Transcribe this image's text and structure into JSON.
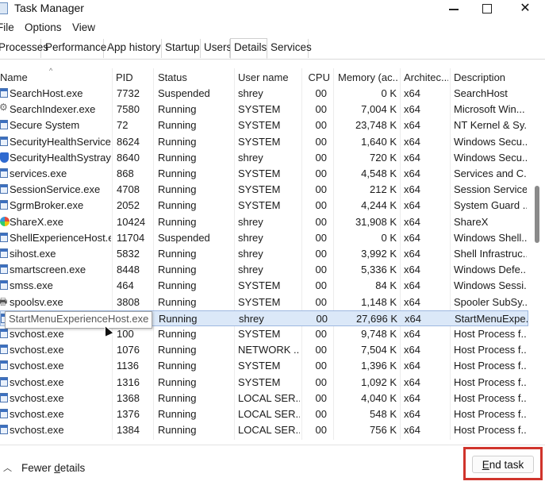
{
  "window": {
    "title": "Task Manager",
    "min_glyph": "—",
    "max_glyph": "",
    "close_glyph": "✕"
  },
  "menu": [
    "File",
    "Options",
    "View"
  ],
  "tabs": [
    {
      "label": "Processes",
      "active": false
    },
    {
      "label": "Performance",
      "active": false
    },
    {
      "label": "App history",
      "active": false
    },
    {
      "label": "Startup",
      "active": false
    },
    {
      "label": "Users",
      "active": false
    },
    {
      "label": "Details",
      "active": true
    },
    {
      "label": "Services",
      "active": false
    }
  ],
  "columns": [
    "Name",
    "PID",
    "Status",
    "User name",
    "CPU",
    "Memory (ac...",
    "Architec...",
    "Description"
  ],
  "sort_indicator": "^",
  "rows": [
    {
      "icon": "window",
      "name": "SearchHost.exe",
      "pid": "7732",
      "status": "Suspended",
      "user": "shrey",
      "cpu": "00",
      "mem": "0 K",
      "arch": "x64",
      "desc": "SearchHost"
    },
    {
      "icon": "gear",
      "name": "SearchIndexer.exe",
      "pid": "7580",
      "status": "Running",
      "user": "SYSTEM",
      "cpu": "00",
      "mem": "7,004 K",
      "arch": "x64",
      "desc": "Microsoft Win..."
    },
    {
      "icon": "window",
      "name": "Secure System",
      "pid": "72",
      "status": "Running",
      "user": "SYSTEM",
      "cpu": "00",
      "mem": "23,748 K",
      "arch": "x64",
      "desc": "NT Kernel & Sy..."
    },
    {
      "icon": "window",
      "name": "SecurityHealthService...",
      "pid": "8624",
      "status": "Running",
      "user": "SYSTEM",
      "cpu": "00",
      "mem": "1,640 K",
      "arch": "x64",
      "desc": "Windows Secu..."
    },
    {
      "icon": "shield",
      "name": "SecurityHealthSystray...",
      "pid": "8640",
      "status": "Running",
      "user": "shrey",
      "cpu": "00",
      "mem": "720 K",
      "arch": "x64",
      "desc": "Windows Secu..."
    },
    {
      "icon": "window",
      "name": "services.exe",
      "pid": "868",
      "status": "Running",
      "user": "SYSTEM",
      "cpu": "00",
      "mem": "4,548 K",
      "arch": "x64",
      "desc": "Services and C..."
    },
    {
      "icon": "window",
      "name": "SessionService.exe",
      "pid": "4708",
      "status": "Running",
      "user": "SYSTEM",
      "cpu": "00",
      "mem": "212 K",
      "arch": "x64",
      "desc": "Session  Service"
    },
    {
      "icon": "window",
      "name": "SgrmBroker.exe",
      "pid": "2052",
      "status": "Running",
      "user": "SYSTEM",
      "cpu": "00",
      "mem": "4,244 K",
      "arch": "x64",
      "desc": "System Guard ..."
    },
    {
      "icon": "sharex",
      "name": "ShareX.exe",
      "pid": "10424",
      "status": "Running",
      "user": "shrey",
      "cpu": "00",
      "mem": "31,908 K",
      "arch": "x64",
      "desc": "ShareX"
    },
    {
      "icon": "window",
      "name": "ShellExperienceHost.e...",
      "pid": "11704",
      "status": "Suspended",
      "user": "shrey",
      "cpu": "00",
      "mem": "0 K",
      "arch": "x64",
      "desc": "Windows Shell..."
    },
    {
      "icon": "window",
      "name": "sihost.exe",
      "pid": "5832",
      "status": "Running",
      "user": "shrey",
      "cpu": "00",
      "mem": "3,992 K",
      "arch": "x64",
      "desc": "Shell Infrastruc..."
    },
    {
      "icon": "window",
      "name": "smartscreen.exe",
      "pid": "8448",
      "status": "Running",
      "user": "shrey",
      "cpu": "00",
      "mem": "5,336 K",
      "arch": "x64",
      "desc": "Windows Defe..."
    },
    {
      "icon": "window",
      "name": "smss.exe",
      "pid": "464",
      "status": "Running",
      "user": "SYSTEM",
      "cpu": "00",
      "mem": "84 K",
      "arch": "x64",
      "desc": "Windows Sessi..."
    },
    {
      "icon": "printer",
      "name": "spoolsv.exe",
      "pid": "3808",
      "status": "Running",
      "user": "SYSTEM",
      "cpu": "00",
      "mem": "1,148 K",
      "arch": "x64",
      "desc": "Spooler SubSy..."
    },
    {
      "icon": "window",
      "name": "",
      "pid": "",
      "status": "Running",
      "user": "shrey",
      "cpu": "00",
      "mem": "27,696 K",
      "arch": "x64",
      "desc": "StartMenuExpe...",
      "selected": true
    },
    {
      "icon": "window",
      "name": "svchost.exe",
      "pid": "100",
      "status": "Running",
      "user": "SYSTEM",
      "cpu": "00",
      "mem": "9,748 K",
      "arch": "x64",
      "desc": "Host Process f..."
    },
    {
      "icon": "window",
      "name": "svchost.exe",
      "pid": "1076",
      "status": "Running",
      "user": "NETWORK ...",
      "cpu": "00",
      "mem": "7,504 K",
      "arch": "x64",
      "desc": "Host Process f..."
    },
    {
      "icon": "window",
      "name": "svchost.exe",
      "pid": "1136",
      "status": "Running",
      "user": "SYSTEM",
      "cpu": "00",
      "mem": "1,396 K",
      "arch": "x64",
      "desc": "Host Process f..."
    },
    {
      "icon": "window",
      "name": "svchost.exe",
      "pid": "1316",
      "status": "Running",
      "user": "SYSTEM",
      "cpu": "00",
      "mem": "1,092 K",
      "arch": "x64",
      "desc": "Host Process f..."
    },
    {
      "icon": "window",
      "name": "svchost.exe",
      "pid": "1368",
      "status": "Running",
      "user": "LOCAL SER...",
      "cpu": "00",
      "mem": "4,040 K",
      "arch": "x64",
      "desc": "Host Process f..."
    },
    {
      "icon": "window",
      "name": "svchost.exe",
      "pid": "1376",
      "status": "Running",
      "user": "LOCAL SER...",
      "cpu": "00",
      "mem": "548 K",
      "arch": "x64",
      "desc": "Host Process f..."
    },
    {
      "icon": "window",
      "name": "svchost.exe",
      "pid": "1384",
      "status": "Running",
      "user": "LOCAL SER...",
      "cpu": "00",
      "mem": "756 K",
      "arch": "x64",
      "desc": "Host Process f..."
    }
  ],
  "tooltip": "StartMenuExperienceHost.exe",
  "footer": {
    "fewer_prefix": "Fewer ",
    "fewer_underlined": "d",
    "fewer_suffix": "etails",
    "end_prefix": "",
    "end_underlined": "E",
    "end_suffix": "nd task"
  }
}
